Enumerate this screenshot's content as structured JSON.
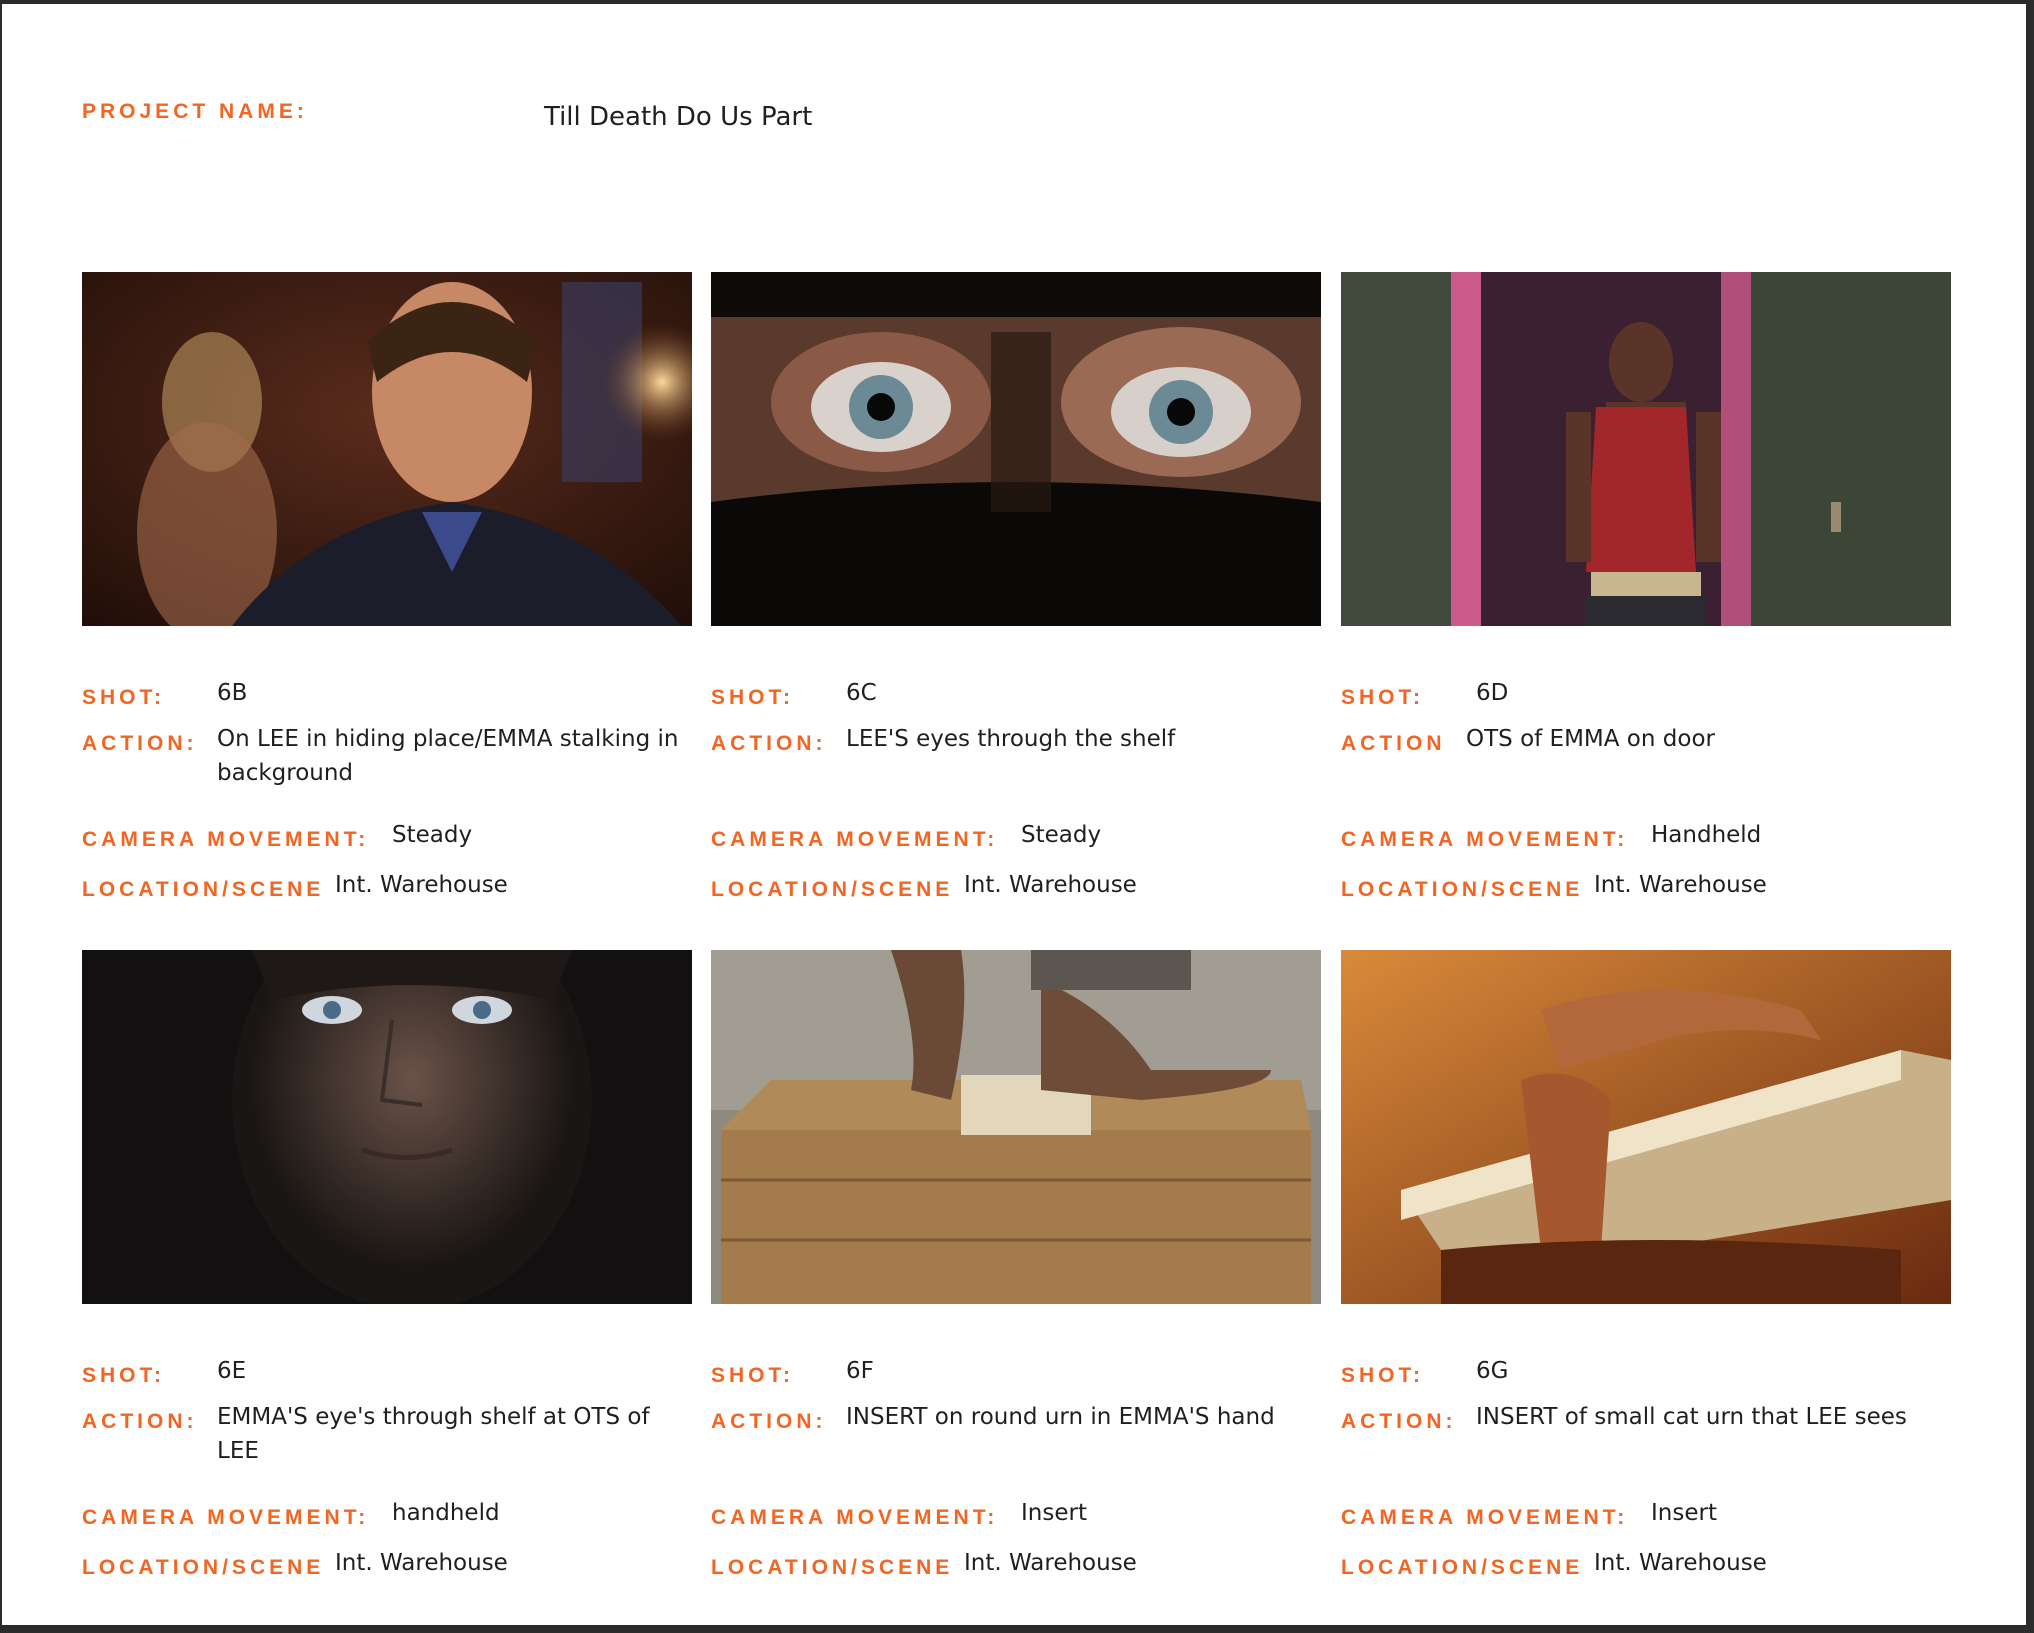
{
  "project": {
    "label": "PROJECT NAME:",
    "value": "Till Death Do Us Part"
  },
  "labels": {
    "shot": "SHOT:",
    "action_colon": "ACTION:",
    "action_plain": "ACTION",
    "camera": "CAMERA MOVEMENT:",
    "location": "LOCATION/SCENE"
  },
  "shots": [
    {
      "shot": "6B",
      "action": "On LEE in hiding place/EMMA stalking in background",
      "camera": "Steady",
      "location": "Int. Warehouse",
      "image": "man in suit with woman blurred in background"
    },
    {
      "shot": "6C",
      "action": "LEE'S eyes through the shelf",
      "camera": "Steady",
      "location": "Int. Warehouse",
      "image": "close-up of eyes peering through a gap"
    },
    {
      "shot": "6D",
      "action": "OTS of EMMA on door",
      "camera": "Handheld",
      "location": "Int. Warehouse",
      "image": "woman in red top standing in a doorway"
    },
    {
      "shot": "6E",
      "action": "EMMA'S eye's through shelf at OTS of LEE",
      "camera": "handheld",
      "location": "Int. Warehouse",
      "image": "man's face in a dark shadowy space"
    },
    {
      "shot": "6F",
      "action": "INSERT on round urn in EMMA'S hand",
      "camera": "Insert",
      "location": "Int. Warehouse",
      "image": "hands resting on a wooden box"
    },
    {
      "shot": "6G",
      "action": "INSERT of small cat urn that LEE sees",
      "camera": "Insert",
      "location": "Int. Warehouse",
      "image": "hands holding a book in warm light"
    }
  ]
}
